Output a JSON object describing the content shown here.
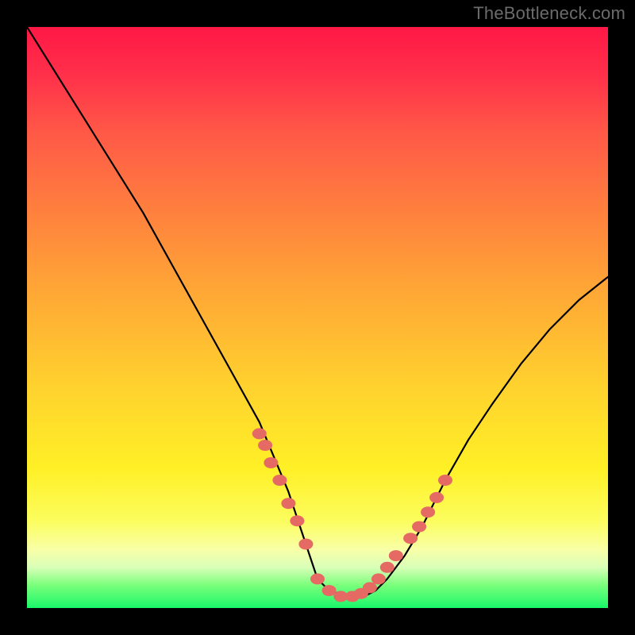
{
  "attribution": "TheBottleneck.com",
  "chart_data": {
    "type": "line",
    "title": "",
    "xlabel": "",
    "ylabel": "",
    "xlim": [
      0,
      100
    ],
    "ylim": [
      0,
      100
    ],
    "grid": false,
    "legend": false,
    "series": [
      {
        "name": "bottleneck-curve",
        "color": "#000000",
        "x": [
          0,
          5,
          10,
          15,
          20,
          25,
          30,
          35,
          40,
          45,
          47,
          50,
          52,
          55,
          58,
          60,
          62,
          65,
          68,
          72,
          76,
          80,
          85,
          90,
          95,
          100
        ],
        "y": [
          100,
          92,
          84,
          76,
          68,
          59,
          50,
          41,
          32,
          20,
          14,
          5,
          3,
          2,
          2,
          3,
          5,
          9,
          14,
          22,
          29,
          35,
          42,
          48,
          53,
          57
        ]
      }
    ],
    "highlights": {
      "name": "trough-dots",
      "color": "#e56a63",
      "x": [
        40,
        41,
        42,
        43.5,
        45,
        46.5,
        48,
        50,
        52,
        54,
        56,
        57.5,
        59,
        60.5,
        62,
        63.5,
        66,
        67.5,
        69,
        70.5,
        72
      ],
      "y": [
        30,
        28,
        25,
        22,
        18,
        15,
        11,
        5,
        3,
        2,
        2,
        2.5,
        3.5,
        5,
        7,
        9,
        12,
        14,
        16.5,
        19,
        22
      ]
    }
  }
}
